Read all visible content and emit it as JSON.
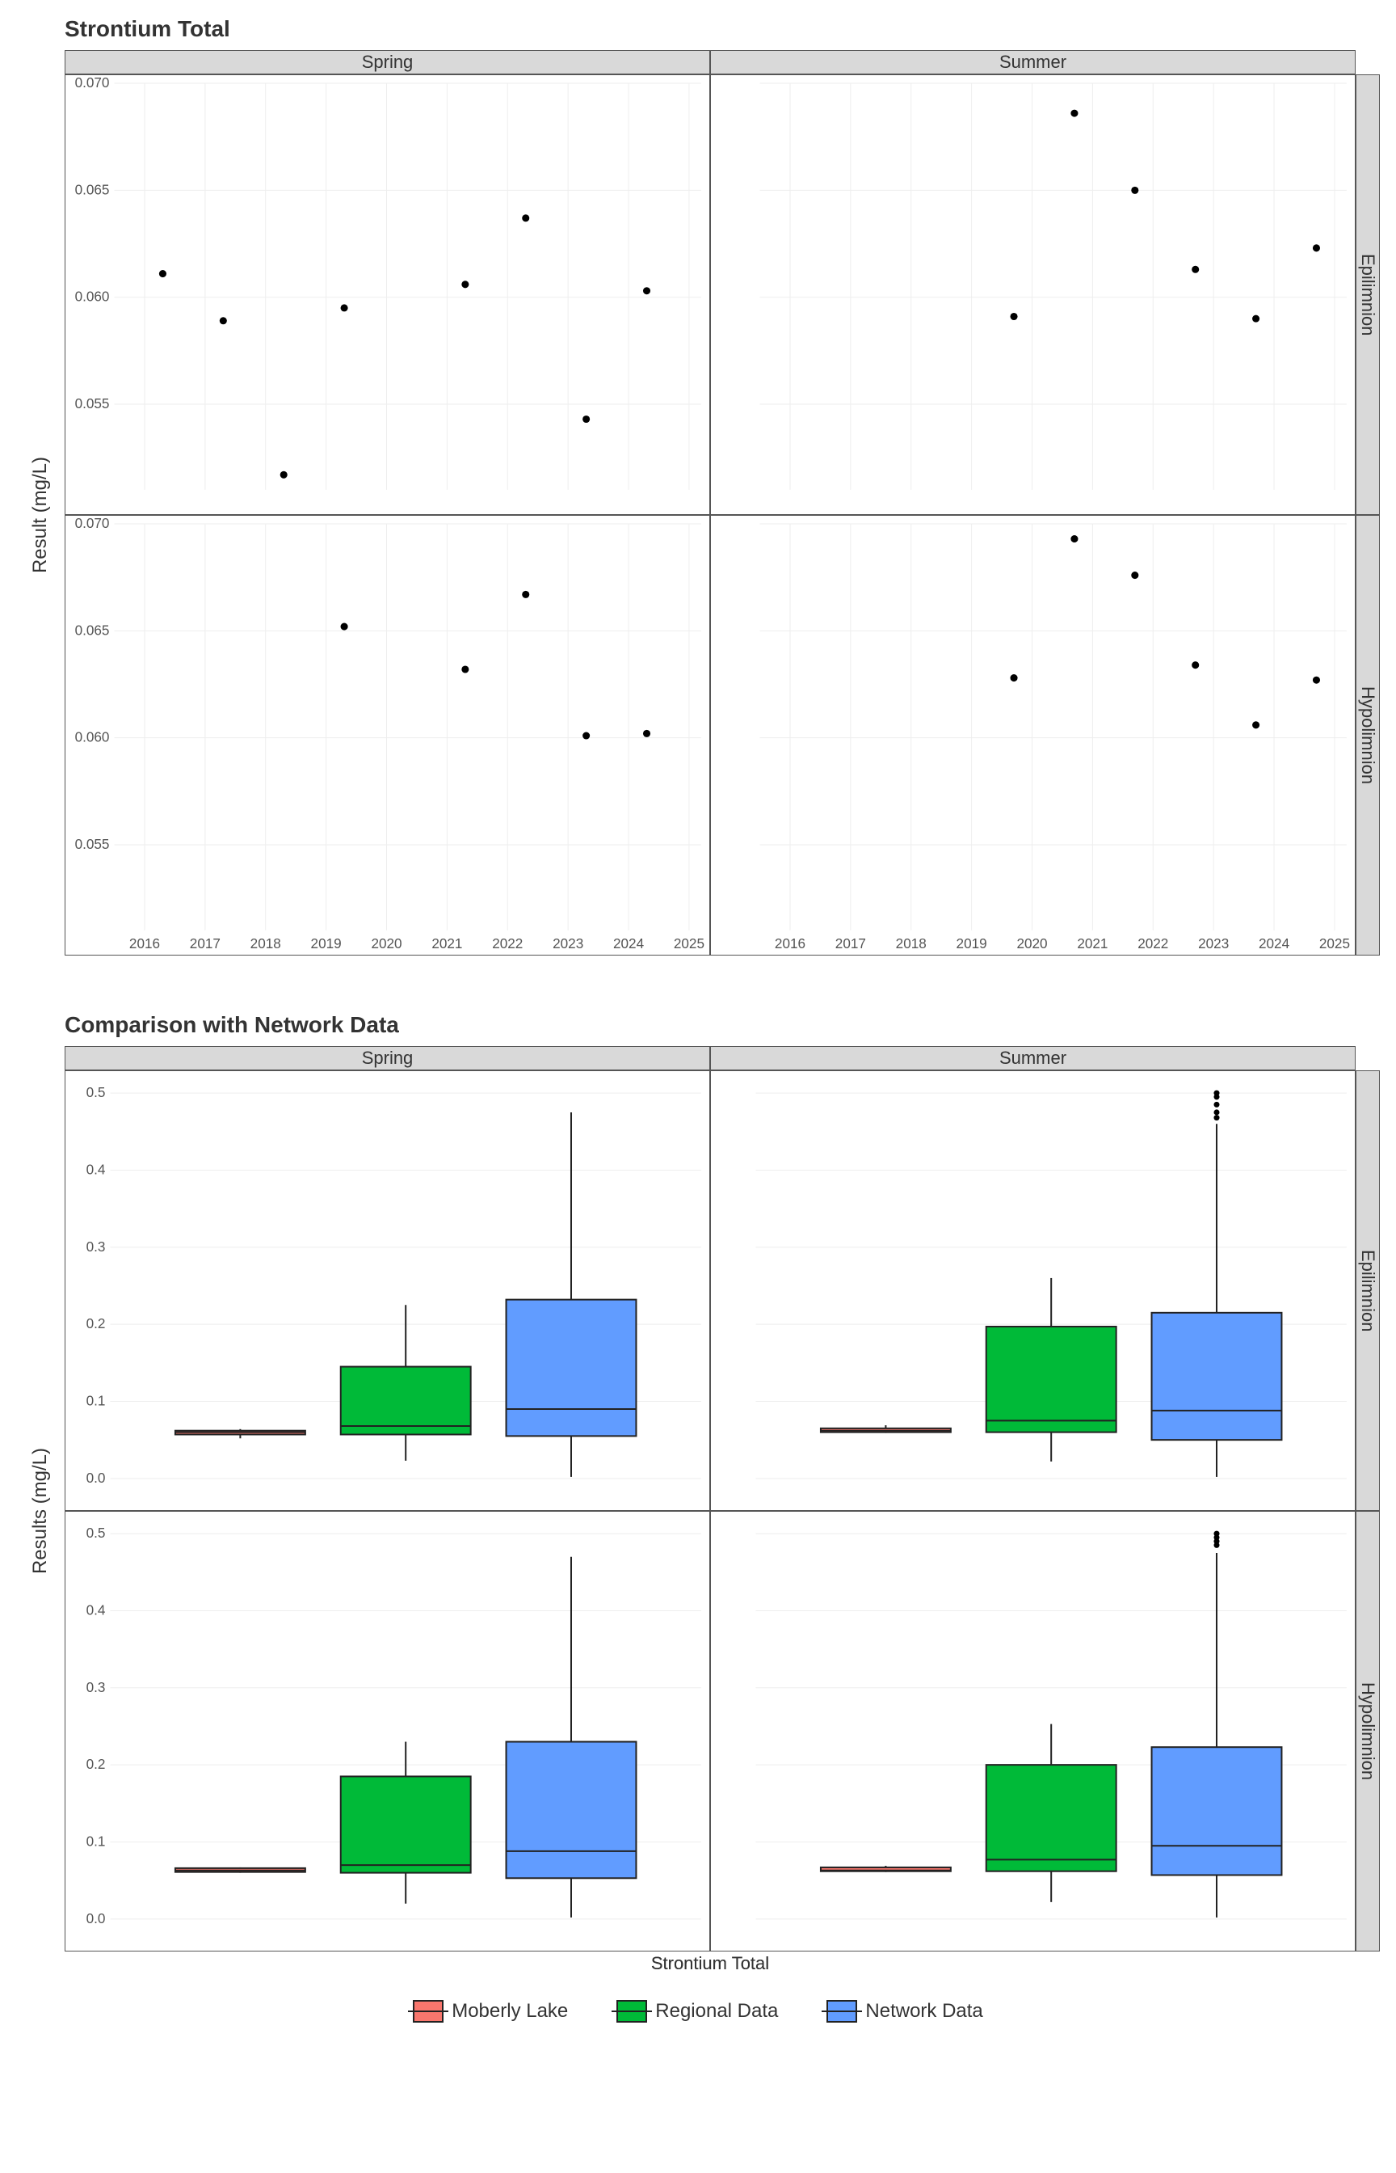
{
  "chart_data": [
    {
      "type": "scatter",
      "title": "Strontium Total",
      "ylabel": "Result (mg/L)",
      "xlabel": "",
      "facet_cols": [
        "Spring",
        "Summer"
      ],
      "facet_rows": [
        "Epilimnion",
        "Hypolimnion"
      ],
      "x_ticks": [
        2016,
        2017,
        2018,
        2019,
        2020,
        2021,
        2022,
        2023,
        2024,
        2025
      ],
      "y_ticks": [
        0.055,
        0.06,
        0.065,
        0.07
      ],
      "ylim": [
        0.051,
        0.07
      ],
      "xlim": [
        2015.5,
        2025.2
      ],
      "panels": {
        "Spring|Epilimnion": [
          {
            "x": 2016.3,
            "y": 0.0611
          },
          {
            "x": 2017.3,
            "y": 0.0589
          },
          {
            "x": 2018.3,
            "y": 0.0517
          },
          {
            "x": 2019.3,
            "y": 0.0595
          },
          {
            "x": 2021.3,
            "y": 0.0606
          },
          {
            "x": 2022.3,
            "y": 0.0637
          },
          {
            "x": 2023.3,
            "y": 0.0543
          },
          {
            "x": 2024.3,
            "y": 0.0603
          }
        ],
        "Summer|Epilimnion": [
          {
            "x": 2019.7,
            "y": 0.0591
          },
          {
            "x": 2020.7,
            "y": 0.0686
          },
          {
            "x": 2021.7,
            "y": 0.065
          },
          {
            "x": 2022.7,
            "y": 0.0613
          },
          {
            "x": 2023.7,
            "y": 0.059
          },
          {
            "x": 2024.7,
            "y": 0.0623
          }
        ],
        "Spring|Hypolimnion": [
          {
            "x": 2019.3,
            "y": 0.0652
          },
          {
            "x": 2021.3,
            "y": 0.0632
          },
          {
            "x": 2022.3,
            "y": 0.0667
          },
          {
            "x": 2023.3,
            "y": 0.0601
          },
          {
            "x": 2024.3,
            "y": 0.0602
          }
        ],
        "Summer|Hypolimnion": [
          {
            "x": 2019.7,
            "y": 0.0628
          },
          {
            "x": 2020.7,
            "y": 0.0693
          },
          {
            "x": 2021.7,
            "y": 0.0676
          },
          {
            "x": 2022.7,
            "y": 0.0634
          },
          {
            "x": 2023.7,
            "y": 0.0606
          },
          {
            "x": 2024.7,
            "y": 0.0627
          }
        ]
      }
    },
    {
      "type": "boxplot",
      "title": "Comparison with Network Data",
      "ylabel": "Results (mg/L)",
      "xlabel": "Strontium Total",
      "facet_cols": [
        "Spring",
        "Summer"
      ],
      "facet_rows": [
        "Epilimnion",
        "Hypolimnion"
      ],
      "y_ticks": [
        0.0,
        0.1,
        0.2,
        0.3,
        0.4,
        0.5
      ],
      "ylim": [
        -0.02,
        0.52
      ],
      "legend": [
        {
          "name": "Moberly Lake",
          "color": "#F8766D"
        },
        {
          "name": "Regional Data",
          "color": "#00BA38"
        },
        {
          "name": "Network Data",
          "color": "#619CFF"
        }
      ],
      "panels": {
        "Spring|Epilimnion": [
          {
            "g": "Moberly Lake",
            "min": 0.052,
            "q1": 0.057,
            "med": 0.06,
            "q3": 0.062,
            "max": 0.064,
            "out": []
          },
          {
            "g": "Regional Data",
            "min": 0.023,
            "q1": 0.057,
            "med": 0.068,
            "q3": 0.145,
            "max": 0.225,
            "out": []
          },
          {
            "g": "Network Data",
            "min": 0.002,
            "q1": 0.055,
            "med": 0.09,
            "q3": 0.232,
            "max": 0.475,
            "out": []
          }
        ],
        "Summer|Epilimnion": [
          {
            "g": "Moberly Lake",
            "min": 0.059,
            "q1": 0.06,
            "med": 0.062,
            "q3": 0.065,
            "max": 0.069,
            "out": []
          },
          {
            "g": "Regional Data",
            "min": 0.022,
            "q1": 0.06,
            "med": 0.075,
            "q3": 0.197,
            "max": 0.26,
            "out": []
          },
          {
            "g": "Network Data",
            "min": 0.002,
            "q1": 0.05,
            "med": 0.088,
            "q3": 0.215,
            "max": 0.46,
            "out": [
              0.468,
              0.475,
              0.485,
              0.495,
              0.5
            ]
          }
        ],
        "Spring|Hypolimnion": [
          {
            "g": "Moberly Lake",
            "min": 0.06,
            "q1": 0.061,
            "med": 0.063,
            "q3": 0.066,
            "max": 0.067,
            "out": []
          },
          {
            "g": "Regional Data",
            "min": 0.02,
            "q1": 0.06,
            "med": 0.07,
            "q3": 0.185,
            "max": 0.23,
            "out": []
          },
          {
            "g": "Network Data",
            "min": 0.002,
            "q1": 0.053,
            "med": 0.088,
            "q3": 0.23,
            "max": 0.47,
            "out": []
          }
        ],
        "Summer|Hypolimnion": [
          {
            "g": "Moberly Lake",
            "min": 0.061,
            "q1": 0.062,
            "med": 0.063,
            "q3": 0.067,
            "max": 0.069,
            "out": []
          },
          {
            "g": "Regional Data",
            "min": 0.022,
            "q1": 0.062,
            "med": 0.077,
            "q3": 0.2,
            "max": 0.253,
            "out": []
          },
          {
            "g": "Network Data",
            "min": 0.002,
            "q1": 0.057,
            "med": 0.095,
            "q3": 0.223,
            "max": 0.475,
            "out": [
              0.485,
              0.49,
              0.495,
              0.5
            ]
          }
        ]
      }
    }
  ]
}
